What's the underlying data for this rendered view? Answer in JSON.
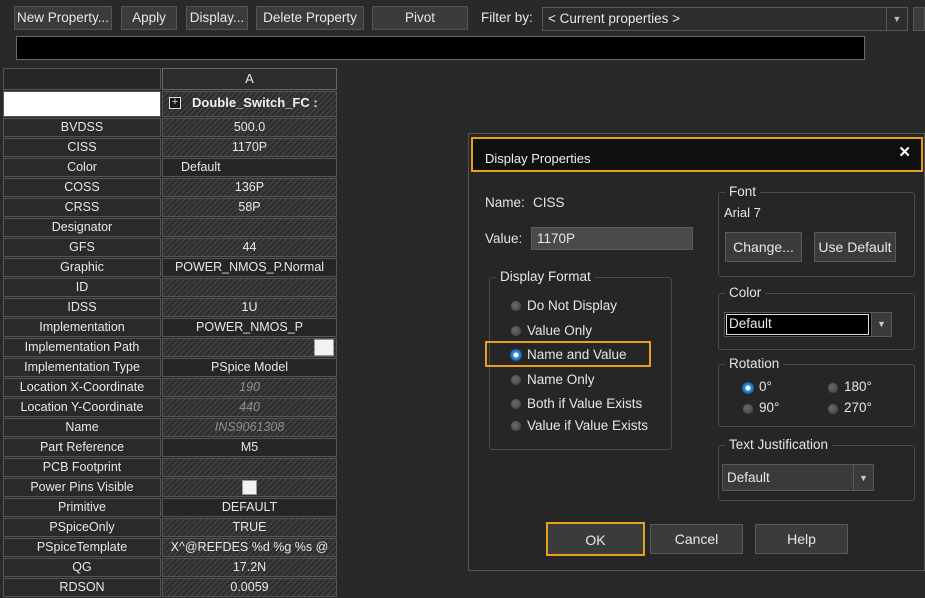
{
  "toolbar": {
    "new_property": "New Property...",
    "apply": "Apply",
    "display": "Display...",
    "delete_property": "Delete Property",
    "pivot": "Pivot",
    "filter_label": "Filter by:",
    "filter_value": "< Current properties >"
  },
  "grid": {
    "column_header": "A",
    "part_name": "Double_Switch_FC :",
    "rows": [
      {
        "label": "BVDSS",
        "value": "500.0"
      },
      {
        "label": "CISS",
        "value": "1170P"
      },
      {
        "label": "Color",
        "value": "Default"
      },
      {
        "label": "COSS",
        "value": "136P"
      },
      {
        "label": "CRSS",
        "value": "58P"
      },
      {
        "label": "Designator",
        "value": ""
      },
      {
        "label": "GFS",
        "value": "44"
      },
      {
        "label": "Graphic",
        "value": "POWER_NMOS_P.Normal"
      },
      {
        "label": "ID",
        "value": ""
      },
      {
        "label": "IDSS",
        "value": "1U"
      },
      {
        "label": "Implementation",
        "value": "POWER_NMOS_P"
      },
      {
        "label": "Implementation Path",
        "value": ""
      },
      {
        "label": "Implementation Type",
        "value": "PSpice Model"
      },
      {
        "label": "Location X-Coordinate",
        "value": "190"
      },
      {
        "label": "Location Y-Coordinate",
        "value": "440"
      },
      {
        "label": "Name",
        "value": "INS9061308"
      },
      {
        "label": "Part Reference",
        "value": "M5"
      },
      {
        "label": "PCB Footprint",
        "value": ""
      },
      {
        "label": "Power Pins Visible",
        "value": ""
      },
      {
        "label": "Primitive",
        "value": "DEFAULT"
      },
      {
        "label": "PSpiceOnly",
        "value": "TRUE"
      },
      {
        "label": "PSpiceTemplate",
        "value": "X^@REFDES %d %g %s @"
      },
      {
        "label": "QG",
        "value": "17.2N"
      },
      {
        "label": "RDSON",
        "value": "0.0059"
      }
    ]
  },
  "dialog": {
    "title": "Display Properties",
    "close_glyph": "✕",
    "name_label": "Name:",
    "name_value": "CISS",
    "value_label": "Value:",
    "value_value": "1170P",
    "display_format": {
      "title": "Display Format",
      "options": [
        "Do Not Display",
        "Value Only",
        "Name and Value",
        "Name Only",
        "Both if Value Exists",
        "Value if Value Exists"
      ],
      "selected": "Name and Value"
    },
    "font": {
      "title": "Font",
      "current": "Arial 7",
      "change_button": "Change...",
      "use_default_button": "Use Default"
    },
    "color": {
      "title": "Color",
      "value": "Default"
    },
    "rotation": {
      "title": "Rotation",
      "options": [
        "0°",
        "180°",
        "90°",
        "270°"
      ],
      "selected": "0°"
    },
    "text_justification": {
      "title": "Text Justification",
      "value": "Default"
    },
    "ok_button": "OK",
    "cancel_button": "Cancel",
    "help_button": "Help"
  },
  "colors": {
    "highlight": "#e5a11c",
    "background": "#292929",
    "radio_selected": "#2a8ae0"
  }
}
